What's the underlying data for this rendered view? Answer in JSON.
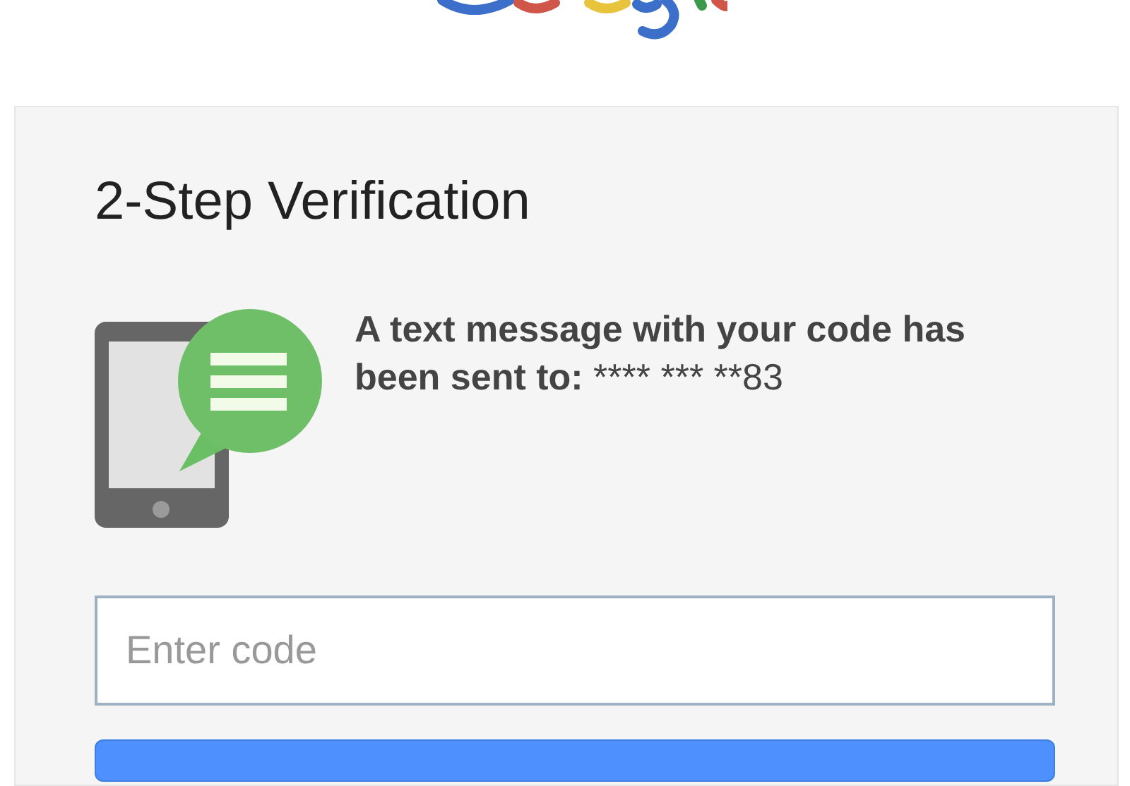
{
  "card": {
    "title": "2-Step Verification",
    "message": "A text message with your code has been sent to:",
    "masked_number": "**** *** **83",
    "code_field": {
      "placeholder": "Enter code"
    }
  }
}
